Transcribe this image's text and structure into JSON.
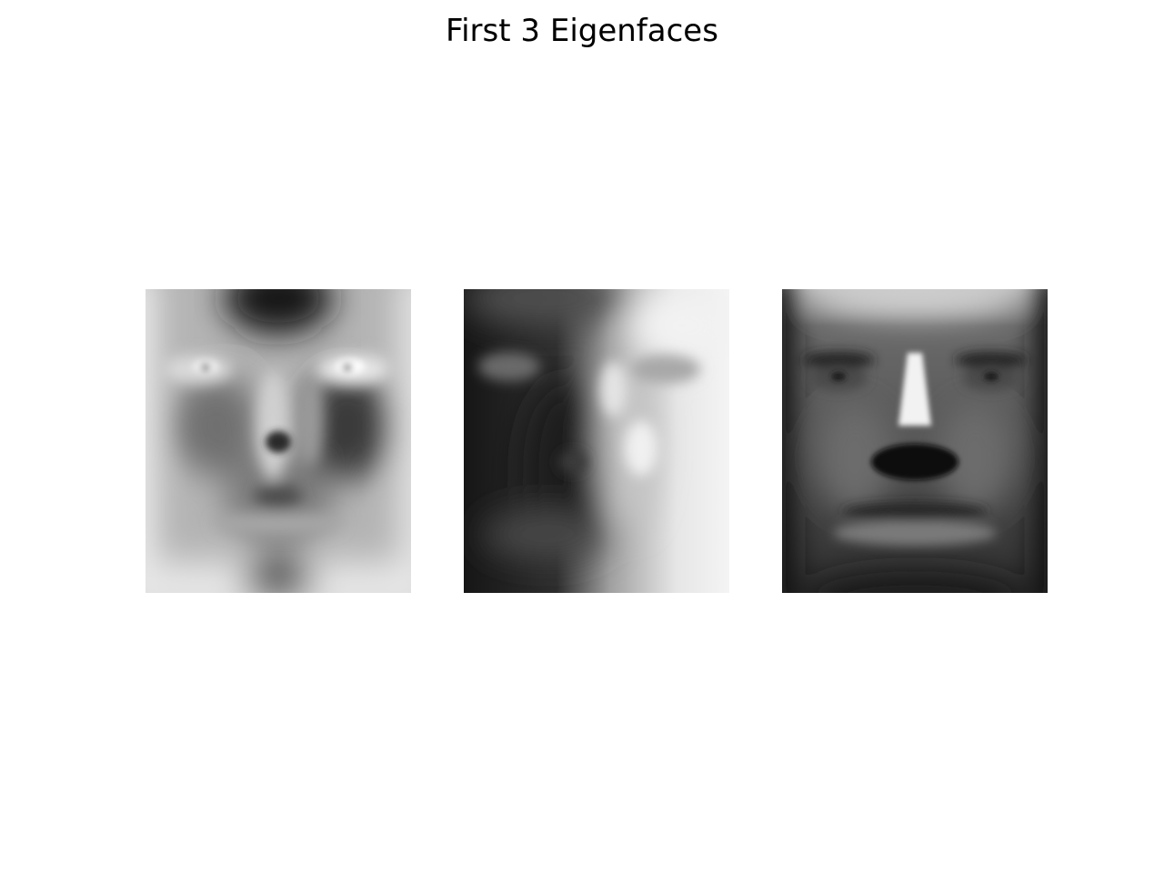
{
  "figure": {
    "title": "First 3 Eigenfaces"
  },
  "panels": [
    {
      "id": "eigenface-1",
      "colormap": "gray"
    },
    {
      "id": "eigenface-2",
      "colormap": "gray"
    },
    {
      "id": "eigenface-3",
      "colormap": "gray"
    }
  ]
}
